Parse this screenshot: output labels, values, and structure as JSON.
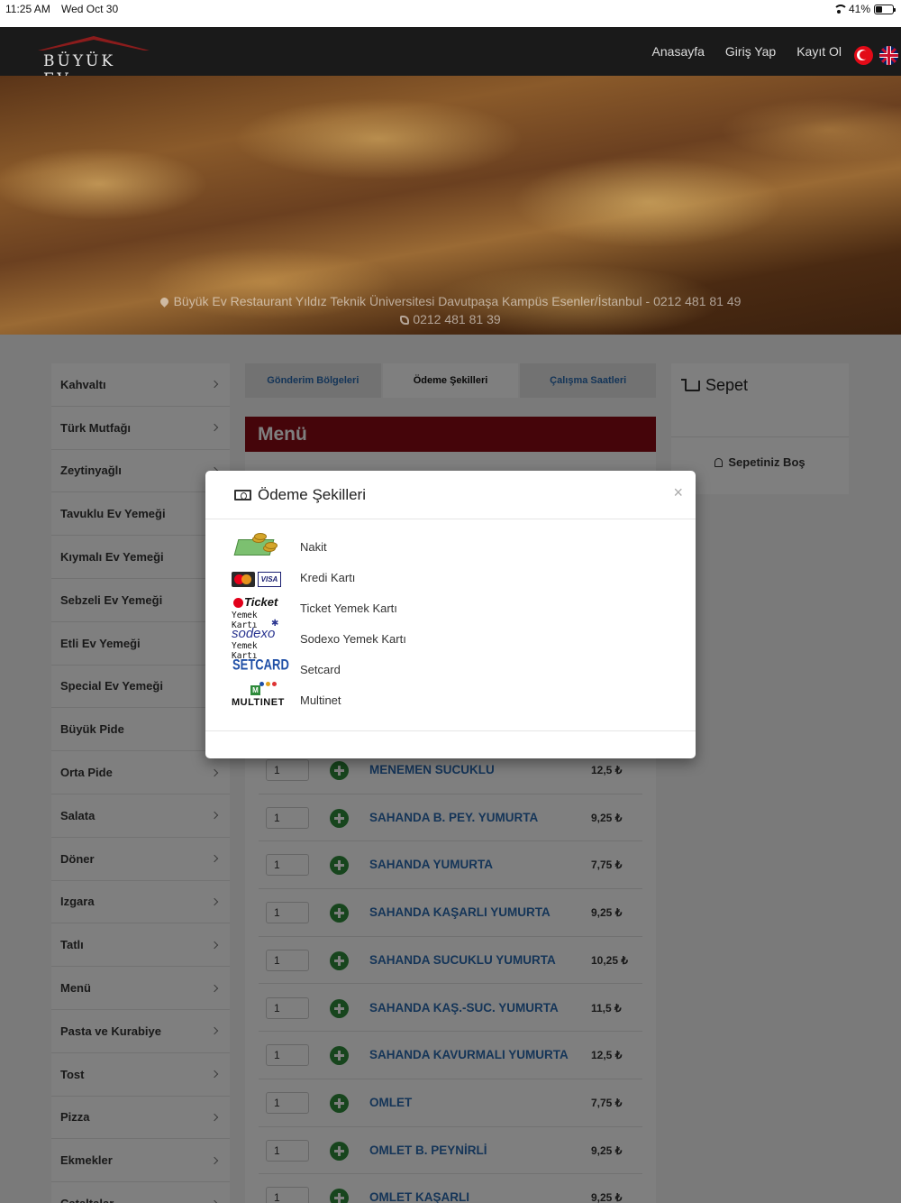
{
  "status_bar": {
    "time": "11:25 AM",
    "date": "Wed Oct 30",
    "battery": "41%",
    "battery_level": 0.41
  },
  "navbar": {
    "logo_text": "BÜYÜK EV",
    "links": [
      "Anasayfa",
      "Giriş Yap",
      "Kayıt Ol"
    ],
    "languages": [
      "tr-flag-icon",
      "uk-flag-icon"
    ],
    "accent_color": "#8b1c1c"
  },
  "hero": {
    "address": "Büyük Ev Restaurant Yıldız Teknik Üniversitesi Davutpaşa Kampüs Esenler/İstanbul - 0212 481 81 49",
    "phone": "0212 481 81 39"
  },
  "categories": [
    "Kahvaltı",
    "Türk Mutfağı",
    "Zeytinyağlı",
    "Tavuklu Ev Yemeği",
    "Kıymalı Ev Yemeği",
    "Sebzeli Ev Yemeği",
    "Etli Ev Yemeği",
    "Special Ev Yemeği",
    "Büyük Pide",
    "Orta Pide",
    "Salata",
    "Döner",
    "Izgara",
    "Tatlı",
    "Menü",
    "Pasta ve Kurabiye",
    "Tost",
    "Pizza",
    "Ekmekler",
    "Çataltalar"
  ],
  "tabs": {
    "delivery": "Gönderim Bölgeleri",
    "payment": "Ödeme Şekilleri",
    "hours": "Çalışma Saatleri"
  },
  "menu": {
    "title": "Menü",
    "header_color": "#8b0b14",
    "items": [
      {
        "qty": "1",
        "name": "MENEMEN SUCUKLU",
        "price": "12,5 ₺"
      },
      {
        "qty": "1",
        "name": "SAHANDA B. PEY. YUMURTA",
        "price": "9,25 ₺"
      },
      {
        "qty": "1",
        "name": "SAHANDA YUMURTA",
        "price": "7,75 ₺"
      },
      {
        "qty": "1",
        "name": "SAHANDA KAŞARLI YUMURTA",
        "price": "9,25 ₺"
      },
      {
        "qty": "1",
        "name": "SAHANDA SUCUKLU YUMURTA",
        "price": "10,25 ₺"
      },
      {
        "qty": "1",
        "name": "SAHANDA KAŞ.-SUC. YUMURTA",
        "price": "11,5 ₺"
      },
      {
        "qty": "1",
        "name": "SAHANDA KAVURMALI YUMURTA",
        "price": "12,5 ₺"
      },
      {
        "qty": "1",
        "name": "OMLET",
        "price": "7,75 ₺"
      },
      {
        "qty": "1",
        "name": "OMLET B. PEYNİRLİ",
        "price": "9,25 ₺"
      },
      {
        "qty": "1",
        "name": "OMLET KAŞARLI",
        "price": "9,25 ₺"
      }
    ]
  },
  "cart": {
    "title": "Sepet",
    "empty_text": "Sepetiniz Boş"
  },
  "modal": {
    "title": "Ödeme Şekilleri",
    "close": "×",
    "methods": [
      {
        "label": "Nakit",
        "icon": "cash-icon"
      },
      {
        "label": "Kredi Kartı",
        "icon": "credit-card-icon"
      },
      {
        "label": "Ticket Yemek Kartı",
        "icon": "ticket-logo",
        "logo_main": "Ticket",
        "logo_sub": "Yemek Kartı"
      },
      {
        "label": "Sodexo Yemek Kartı",
        "icon": "sodexo-logo",
        "logo_main": "sodexo",
        "logo_sub": "Yemek Kartı"
      },
      {
        "label": "Setcard",
        "icon": "setcard-logo",
        "logo_main": "SETCARD"
      },
      {
        "label": "Multinet",
        "icon": "multinet-logo",
        "logo_main": "MULTINET"
      }
    ]
  }
}
